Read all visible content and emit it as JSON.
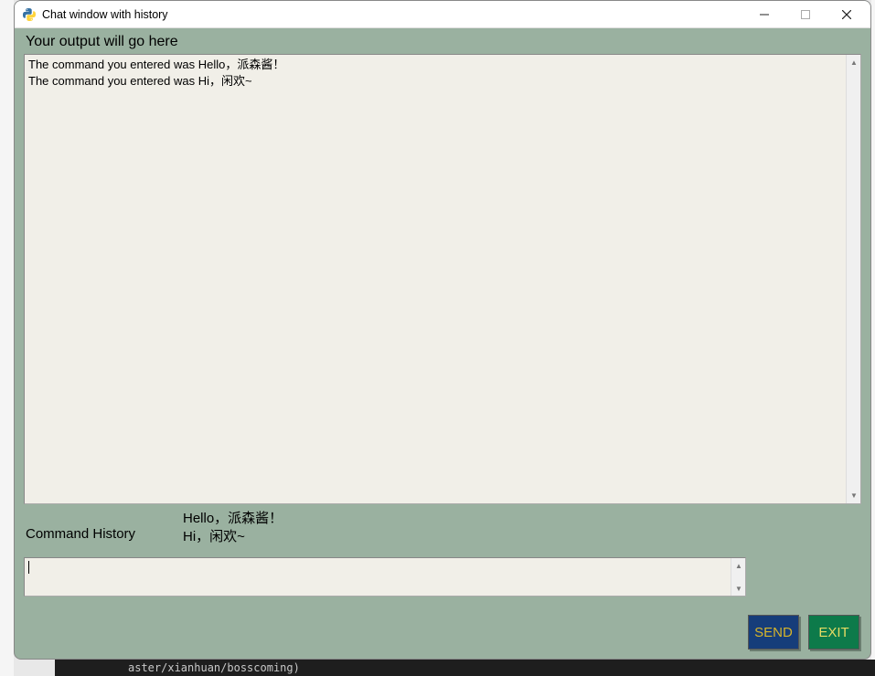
{
  "window": {
    "title": "Chat window with history"
  },
  "header": {
    "label": "Your output will go here"
  },
  "output": {
    "text": "The command you entered was Hello，派森酱！\nThe command you entered was Hi，闲欢~"
  },
  "history": {
    "label": "Command History",
    "entries": [
      "Hello，派森酱！",
      "Hi，闲欢~"
    ],
    "text": "Hello，派森酱！\nHi，闲欢~"
  },
  "input": {
    "value": ""
  },
  "buttons": {
    "send": "SEND",
    "exit": "EXIT"
  },
  "background": {
    "code_fragment": "aster/xianhuan/bosscoming)"
  }
}
